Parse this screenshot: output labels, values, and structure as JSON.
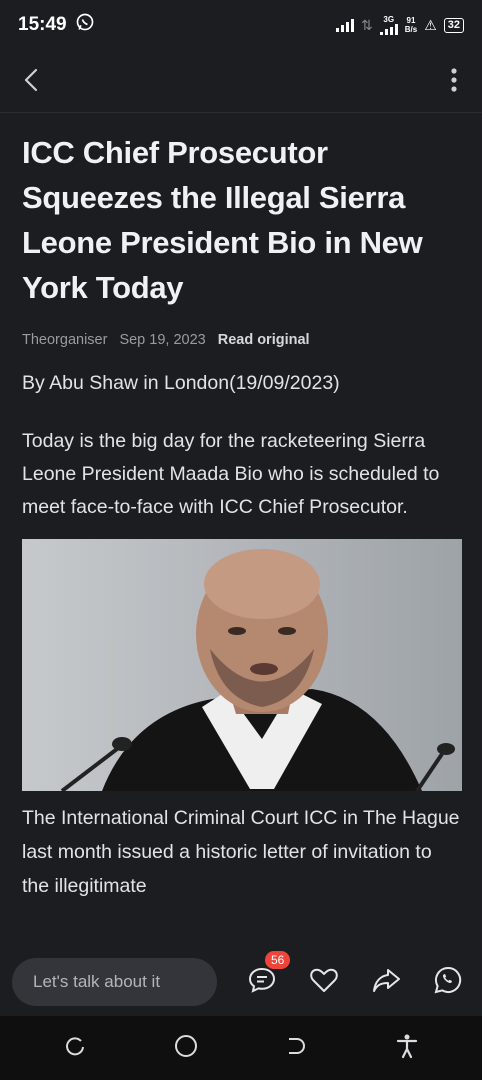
{
  "status_bar": {
    "time": "15:49",
    "network_type": "3G",
    "speed_value": "91",
    "speed_unit": "B/s",
    "battery": "32"
  },
  "article": {
    "title": "ICC Chief Prosecutor Squeezes the Illegal Sierra Leone President Bio in New York Today",
    "source": "Theorganiser",
    "date": "Sep 19, 2023",
    "read_original": "Read original",
    "byline": "By Abu Shaw in London(19/09/2023)",
    "paragraph_1": "Today is the big day for the racketeering Sierra Leone President Maada Bio who is scheduled to meet face-to-face with ICC Chief Prosecutor.",
    "paragraph_2": "The International Criminal Court ICC in The Hague last month issued a historic letter of invitation to the illegitimate"
  },
  "bottom_bar": {
    "comment_placeholder": "Let's talk about it",
    "comment_count": "56"
  },
  "icons": {
    "back": "back-arrow-icon",
    "more": "more-vertical-icon",
    "comment": "comment-icon",
    "like": "heart-icon",
    "share": "share-icon",
    "whatsapp": "whatsapp-icon"
  },
  "colors": {
    "background": "#1c1d20",
    "badge": "#f0443a",
    "input_bg": "#34353a"
  }
}
